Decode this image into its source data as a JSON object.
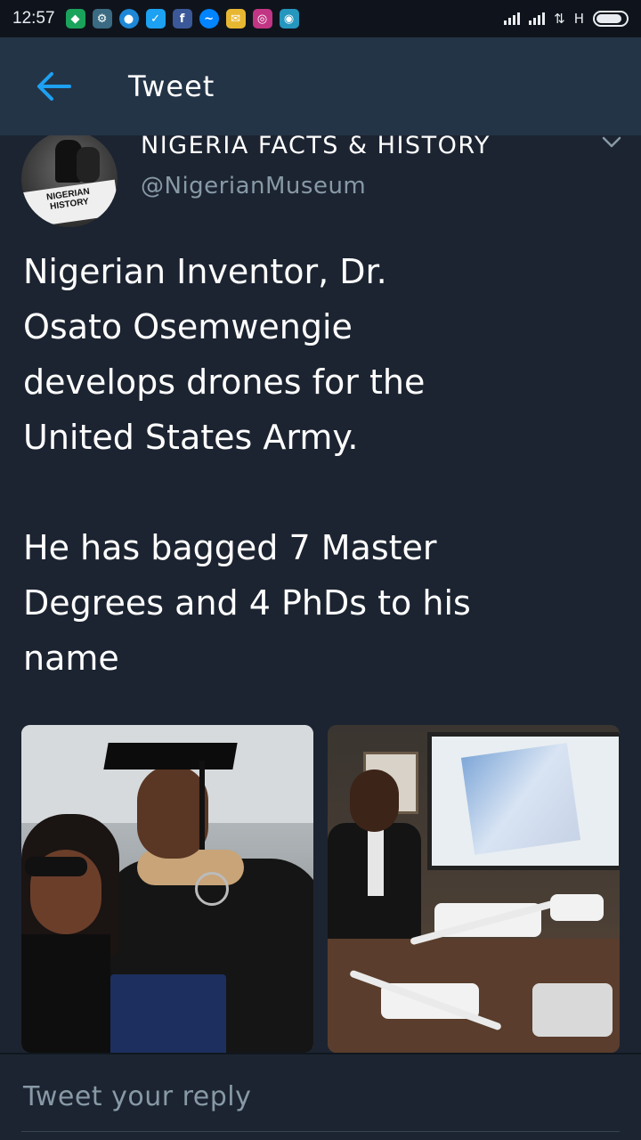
{
  "status_bar": {
    "time": "12:57",
    "network_label": "H",
    "notification_icons": [
      "app-icon",
      "settings-icon",
      "viber-icon",
      "twitter-icon",
      "facebook-icon",
      "messenger-icon",
      "email-icon",
      "instagram-icon",
      "messaging-icon"
    ]
  },
  "header": {
    "title": "Tweet",
    "back_icon": "back-arrow-icon"
  },
  "tweet": {
    "author_name": "NIGERIA FACTS & HISTORY",
    "author_handle": "@NigerianMuseum",
    "avatar_text": "NIGERIAN\nHISTORY",
    "text": "Nigerian Inventor, Dr.\nOsato Osemwengie\ndevelops drones for the\nUnited States Army.\n\nHe has bagged 7 Master\nDegrees and 4 PhDs to his\nname",
    "menu_icon": "chevron-down-icon",
    "media": [
      {
        "description_icon": "photo"
      },
      {
        "description_icon": "photo"
      }
    ]
  },
  "reply": {
    "placeholder": "Tweet your reply"
  },
  "colors": {
    "background": "#1c2431",
    "header": "#243447",
    "secondary_text": "#8899a6",
    "accent": "#1da1f2"
  }
}
